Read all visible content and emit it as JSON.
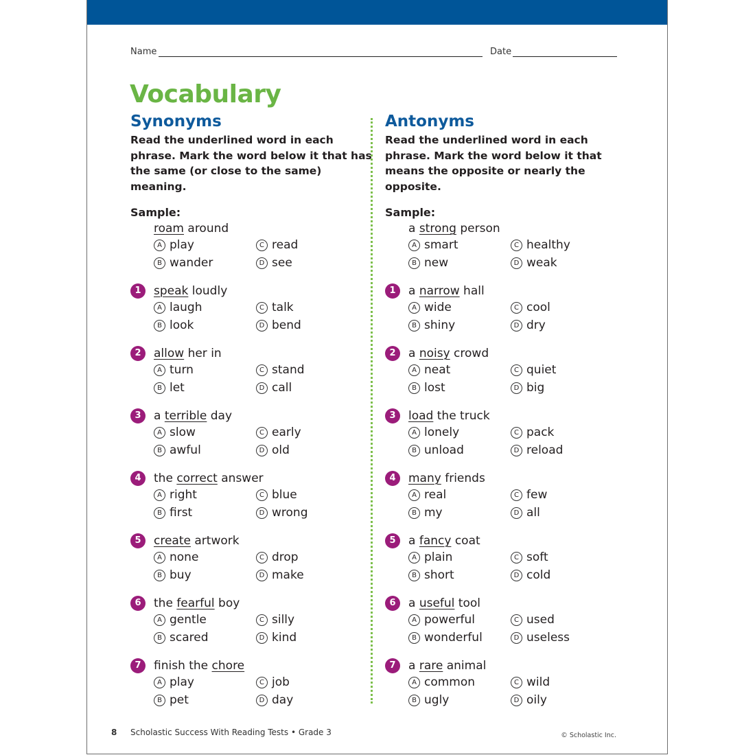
{
  "header": {
    "name_label": "Name",
    "date_label": "Date"
  },
  "title": "Vocabulary",
  "sections": {
    "synonyms": {
      "heading": "Synonyms",
      "instructions": "Read the underlined word in each phrase. Mark the word below it that has the same (or close to the same) meaning.",
      "sample_label": "Sample:",
      "sample": {
        "before": "",
        "target": "roam",
        "after": " around",
        "options": {
          "A": "play",
          "B": "wander",
          "C": "read",
          "D": "see"
        }
      },
      "questions": [
        {
          "number": "1",
          "before": "",
          "target": "speak",
          "after": " loudly",
          "options": {
            "A": "laugh",
            "B": "look",
            "C": "talk",
            "D": "bend"
          }
        },
        {
          "number": "2",
          "before": "",
          "target": "allow",
          "after": " her in",
          "options": {
            "A": "turn",
            "B": "let",
            "C": "stand",
            "D": "call"
          }
        },
        {
          "number": "3",
          "before": "a ",
          "target": "terrible",
          "after": " day",
          "options": {
            "A": "slow",
            "B": "awful",
            "C": "early",
            "D": "old"
          }
        },
        {
          "number": "4",
          "before": "the ",
          "target": "correct",
          "after": " answer",
          "options": {
            "A": "right",
            "B": "first",
            "C": "blue",
            "D": "wrong"
          }
        },
        {
          "number": "5",
          "before": "",
          "target": "create",
          "after": " artwork",
          "options": {
            "A": "none",
            "B": "buy",
            "C": "drop",
            "D": "make"
          }
        },
        {
          "number": "6",
          "before": "the ",
          "target": "fearful",
          "after": " boy",
          "options": {
            "A": "gentle",
            "B": "scared",
            "C": "silly",
            "D": "kind"
          }
        },
        {
          "number": "7",
          "before": "finish the ",
          "target": "chore",
          "after": "",
          "options": {
            "A": "play",
            "B": "pet",
            "C": "job",
            "D": "day"
          }
        }
      ]
    },
    "antonyms": {
      "heading": "Antonyms",
      "instructions": "Read the underlined word in each phrase. Mark the word below it that means the opposite or nearly the opposite.",
      "sample_label": "Sample:",
      "sample": {
        "before": "a ",
        "target": "strong",
        "after": " person",
        "options": {
          "A": "smart",
          "B": "new",
          "C": "healthy",
          "D": "weak"
        }
      },
      "questions": [
        {
          "number": "1",
          "before": "a ",
          "target": "narrow",
          "after": " hall",
          "options": {
            "A": "wide",
            "B": "shiny",
            "C": "cool",
            "D": "dry"
          }
        },
        {
          "number": "2",
          "before": "a ",
          "target": "noisy",
          "after": " crowd",
          "options": {
            "A": "neat",
            "B": "lost",
            "C": "quiet",
            "D": "big"
          }
        },
        {
          "number": "3",
          "before": "",
          "target": "load",
          "after": " the truck",
          "options": {
            "A": "lonely",
            "B": "unload",
            "C": "pack",
            "D": "reload"
          }
        },
        {
          "number": "4",
          "before": "",
          "target": "many",
          "after": " friends",
          "options": {
            "A": "real",
            "B": "my",
            "C": "few",
            "D": "all"
          }
        },
        {
          "number": "5",
          "before": "a ",
          "target": "fancy",
          "after": " coat",
          "options": {
            "A": "plain",
            "B": "short",
            "C": "soft",
            "D": "cold"
          }
        },
        {
          "number": "6",
          "before": "a ",
          "target": "useful",
          "after": " tool",
          "options": {
            "A": "powerful",
            "B": "wonderful",
            "C": "used",
            "D": "useless"
          }
        },
        {
          "number": "7",
          "before": "a ",
          "target": "rare",
          "after": " animal",
          "options": {
            "A": "common",
            "B": "ugly",
            "C": "wild",
            "D": "oily"
          }
        }
      ]
    }
  },
  "footer": {
    "page_number": "8",
    "book_title": "Scholastic Success With Reading Tests • Grade 3",
    "copyright": "© Scholastic Inc."
  },
  "colors": {
    "top_bar": "#005598",
    "title_green": "#6ab545",
    "heading_blue": "#0e5a9c",
    "number_badge": "#9b1c7a",
    "divider_green": "#7cbf4a"
  }
}
